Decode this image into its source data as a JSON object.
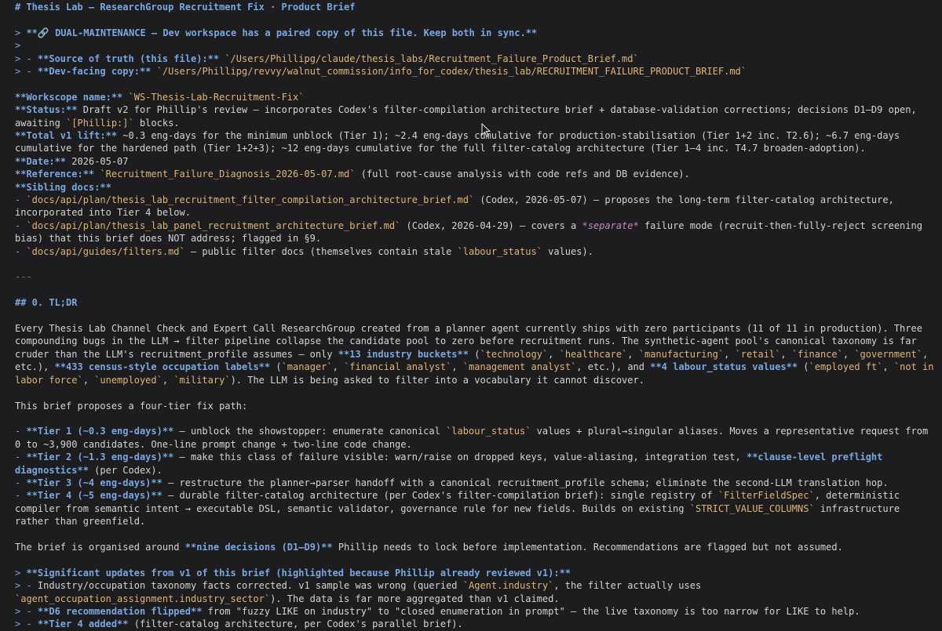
{
  "document": {
    "lines": [
      [
        {
          "t": "h",
          "v": "# Thesis Lab — ResearchGroup Recruitment Fix · Product Brief"
        }
      ],
      [],
      [
        {
          "t": "q",
          "v": "> "
        },
        {
          "t": "b",
          "v": "**🔗 DUAL-MAINTENANCE — Dev workspace has a paired copy of this file. Keep both in sync.**"
        }
      ],
      [
        {
          "t": "q",
          "v": ">"
        }
      ],
      [
        {
          "t": "q",
          "v": "> - "
        },
        {
          "t": "b",
          "v": "**Source of truth (this file):**"
        },
        {
          "t": "n",
          "v": " "
        },
        {
          "t": "c",
          "v": "`/Users/Phillipg/claude/thesis_labs/Recruitment_Failure_Product_Brief.md`"
        }
      ],
      [
        {
          "t": "q",
          "v": "> - "
        },
        {
          "t": "b",
          "v": "**Dev-facing copy:**"
        },
        {
          "t": "n",
          "v": " "
        },
        {
          "t": "c",
          "v": "`/Users/Phillipg/revvy/walnut_commission/info_for_codex/thesis_lab/RECRUITMENT_FAILURE_PRODUCT_BRIEF.md`"
        }
      ],
      [],
      [
        {
          "t": "b",
          "v": "**Workscope name:**"
        },
        {
          "t": "n",
          "v": " "
        },
        {
          "t": "c",
          "v": "`WS-Thesis-Lab-Recruitment-Fix`"
        }
      ],
      [
        {
          "t": "b",
          "v": "**Status:**"
        },
        {
          "t": "n",
          "v": " Draft v2 for Phillip's review — incorporates Codex's filter-compilation architecture brief + database-validation corrections; decisions D1–D9 open, awaiting "
        },
        {
          "t": "c",
          "v": "`[Phillip:]`"
        },
        {
          "t": "n",
          "v": " blocks."
        }
      ],
      [
        {
          "t": "b",
          "v": "**Total v1 lift:**"
        },
        {
          "t": "n",
          "v": " ~0.3 eng-days for the minimum unblock (Tier 1); ~2.4 eng-days cumulative for production-stabilisation (Tier 1+2 inc. T2.6); ~6.7 eng-days cumulative for the hardened path (Tier 1+2+3); ~12 eng-days cumulative for the full filter-catalog architecture (Tier 1–4 inc. T4.7 broaden-adoption)."
        }
      ],
      [
        {
          "t": "b",
          "v": "**Date:**"
        },
        {
          "t": "n",
          "v": " 2026-05-07"
        }
      ],
      [
        {
          "t": "b",
          "v": "**Reference:**"
        },
        {
          "t": "n",
          "v": " "
        },
        {
          "t": "c",
          "v": "`Recruitment_Failure_Diagnosis_2026-05-07.md`"
        },
        {
          "t": "n",
          "v": " (full root-cause analysis with code refs and DB evidence)."
        }
      ],
      [
        {
          "t": "b",
          "v": "**Sibling docs:**"
        }
      ],
      [
        {
          "t": "q",
          "v": "- "
        },
        {
          "t": "c",
          "v": "`docs/api/plan/thesis_lab_recruitment_filter_compilation_architecture_brief.md`"
        },
        {
          "t": "n",
          "v": " (Codex, 2026-05-07) — proposes the long-term filter-catalog architecture, incorporated into Tier 4 below."
        }
      ],
      [
        {
          "t": "q",
          "v": "- "
        },
        {
          "t": "c",
          "v": "`docs/api/plan/thesis_lab_panel_recruitment_architecture_brief.md`"
        },
        {
          "t": "n",
          "v": " (Codex, 2026-04-29) — covers a "
        },
        {
          "t": "i",
          "v": "*separate*"
        },
        {
          "t": "n",
          "v": " failure mode (recruit-then-fully-reject screening bias) that this brief does NOT address; flagged in §9."
        }
      ],
      [
        {
          "t": "q",
          "v": "- "
        },
        {
          "t": "c",
          "v": "`docs/api/guides/filters.md`"
        },
        {
          "t": "n",
          "v": " — public filter docs (themselves contain stale "
        },
        {
          "t": "c",
          "v": "`labour_status`"
        },
        {
          "t": "n",
          "v": " values)."
        }
      ],
      [],
      [
        {
          "t": "m",
          "v": "---"
        }
      ],
      [],
      [
        {
          "t": "h",
          "v": "## 0. TL;DR"
        }
      ],
      [],
      [
        {
          "t": "n",
          "v": "Every Thesis Lab Channel Check and Expert Call ResearchGroup created from a planner agent currently ships with zero participants (11 of 11 in production). Three compounding bugs in the LLM → filter pipeline collapse the candidate pool to zero before recruitment runs. The synthetic-agent pool's canonical taxonomy is far cruder than the LLM's recruitment_profile assumes — only "
        },
        {
          "t": "b",
          "v": "**13 industry buckets**"
        },
        {
          "t": "n",
          "v": " ("
        },
        {
          "t": "c",
          "v": "`technology`"
        },
        {
          "t": "n",
          "v": ", "
        },
        {
          "t": "c",
          "v": "`healthcare`"
        },
        {
          "t": "n",
          "v": ", "
        },
        {
          "t": "c",
          "v": "`manufacturing`"
        },
        {
          "t": "n",
          "v": ", "
        },
        {
          "t": "c",
          "v": "`retail`"
        },
        {
          "t": "n",
          "v": ", "
        },
        {
          "t": "c",
          "v": "`finance`"
        },
        {
          "t": "n",
          "v": ", "
        },
        {
          "t": "c",
          "v": "`government`"
        },
        {
          "t": "n",
          "v": ", etc.), "
        },
        {
          "t": "b",
          "v": "**433 census-style occupation labels**"
        },
        {
          "t": "n",
          "v": " ("
        },
        {
          "t": "c",
          "v": "`manager`"
        },
        {
          "t": "n",
          "v": ", "
        },
        {
          "t": "c",
          "v": "`financial analyst`"
        },
        {
          "t": "n",
          "v": ", "
        },
        {
          "t": "c",
          "v": "`management analyst`"
        },
        {
          "t": "n",
          "v": ", etc.), and "
        },
        {
          "t": "b",
          "v": "**4 labour_status values**"
        },
        {
          "t": "n",
          "v": " ("
        },
        {
          "t": "c",
          "v": "`employed ft`"
        },
        {
          "t": "n",
          "v": ", "
        },
        {
          "t": "c",
          "v": "`not in labor force`"
        },
        {
          "t": "n",
          "v": ", "
        },
        {
          "t": "c",
          "v": "`unemployed`"
        },
        {
          "t": "n",
          "v": ", "
        },
        {
          "t": "c",
          "v": "`military`"
        },
        {
          "t": "n",
          "v": "). The LLM is being asked to filter into a vocabulary it cannot discover."
        }
      ],
      [],
      [
        {
          "t": "n",
          "v": "This brief proposes a four-tier fix path:"
        }
      ],
      [],
      [
        {
          "t": "q",
          "v": "- "
        },
        {
          "t": "b",
          "v": "**Tier 1 (~0.3 eng-days)**"
        },
        {
          "t": "n",
          "v": " — unblock the showstopper: enumerate canonical "
        },
        {
          "t": "c",
          "v": "`labour_status`"
        },
        {
          "t": "n",
          "v": " values + plural→singular aliases. Moves a representative request from 0 to ~3,900 candidates. One-line prompt change + two-line code change."
        }
      ],
      [
        {
          "t": "q",
          "v": "- "
        },
        {
          "t": "b",
          "v": "**Tier 2 (~1.3 eng-days)**"
        },
        {
          "t": "n",
          "v": " — make this class of failure visible: warn/raise on dropped keys, value-aliasing, integration test, "
        },
        {
          "t": "b",
          "v": "**clause-level preflight diagnostics**"
        },
        {
          "t": "n",
          "v": " (per Codex)."
        }
      ],
      [
        {
          "t": "q",
          "v": "- "
        },
        {
          "t": "b",
          "v": "**Tier 3 (~4 eng-days)**"
        },
        {
          "t": "n",
          "v": " — restructure the planner→parser handoff with a canonical recruitment_profile schema; eliminate the second-LLM translation hop."
        }
      ],
      [
        {
          "t": "q",
          "v": "- "
        },
        {
          "t": "b",
          "v": "**Tier 4 (~5 eng-days)**"
        },
        {
          "t": "n",
          "v": " — durable filter-catalog architecture (per Codex's filter-compilation brief): single registry of "
        },
        {
          "t": "c",
          "v": "`FilterFieldSpec`"
        },
        {
          "t": "n",
          "v": ", deterministic compiler from semantic intent → executable DSL, semantic validator, governance rule for new fields. Builds on existing "
        },
        {
          "t": "c",
          "v": "`STRICT_VALUE_COLUMNS`"
        },
        {
          "t": "n",
          "v": " infrastructure rather than greenfield."
        }
      ],
      [],
      [
        {
          "t": "n",
          "v": "The brief is organised around "
        },
        {
          "t": "b",
          "v": "**nine decisions (D1–D9)**"
        },
        {
          "t": "n",
          "v": " Phillip needs to lock before implementation. Recommendations are flagged but not assumed."
        }
      ],
      [],
      [
        {
          "t": "q",
          "v": "> "
        },
        {
          "t": "b",
          "v": "**Significant updates from v1 of this brief (highlighted because Phillip already reviewed v1):**"
        }
      ],
      [
        {
          "t": "q",
          "v": "> - "
        },
        {
          "t": "n",
          "v": "Industry/occupation taxonomy facts corrected. v1 sample was wrong (queried "
        },
        {
          "t": "c",
          "v": "`Agent.industry`"
        },
        {
          "t": "n",
          "v": ", the filter actually uses "
        },
        {
          "t": "c",
          "v": "`agent_occupation_assignment.industry_sector`"
        },
        {
          "t": "n",
          "v": "). The data is far more aggregated than v1 claimed."
        }
      ],
      [
        {
          "t": "q",
          "v": "> - "
        },
        {
          "t": "b",
          "v": "**D6 recommendation flipped**"
        },
        {
          "t": "n",
          "v": " from \"fuzzy LIKE on industry\" to \"closed enumeration in prompt\" — the live taxonomy is too narrow for LIKE to help."
        }
      ],
      [
        {
          "t": "q",
          "v": "> - "
        },
        {
          "t": "b",
          "v": "**Tier 4 added**"
        },
        {
          "t": "n",
          "v": " (filter-catalog architecture, per Codex's parallel brief)."
        }
      ]
    ]
  }
}
